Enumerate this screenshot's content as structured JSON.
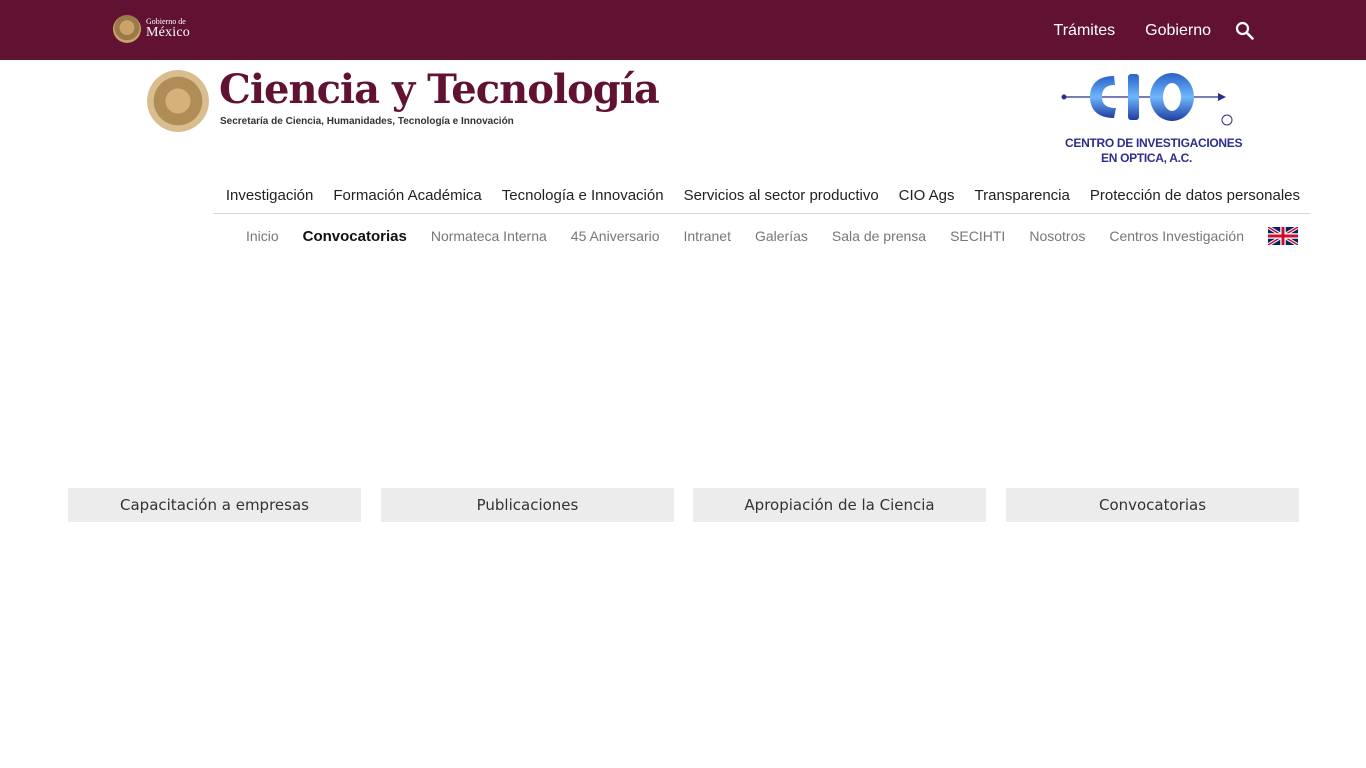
{
  "gov_bar": {
    "logo_small": "Gobierno de",
    "logo_big": "México",
    "nav": [
      "Trámites",
      "Gobierno"
    ],
    "search_icon": "search-icon"
  },
  "header": {
    "brand_title": "Ciencia y Tecnología",
    "brand_subtitle": "Secretaría de Ciencia, Humanidades, Tecnología e Innovación",
    "cio_line1": "CENTRO DE INVESTIGACIONES",
    "cio_line2": "EN OPTICA, A.C.",
    "cio_mark": "®"
  },
  "main_nav": [
    "Investigación",
    "Formación Académica",
    "Tecnología e Innovación",
    "Servicios al sector productivo",
    "CIO Ags",
    "Transparencia",
    "Protección de datos personales"
  ],
  "sub_nav": [
    "Inicio",
    "Convocatorias",
    "Normateca Interna",
    "45 Aniversario",
    "Intranet",
    "Galerías",
    "Sala de prensa",
    "SECIHTI",
    "Nosotros",
    "Centros Investigación"
  ],
  "sub_nav_active": "Convocatorias",
  "cards": [
    "Capacitación a empresas",
    "Publicaciones",
    "Apropiación de la Ciencia",
    "Convocatorias"
  ],
  "colors": {
    "gov_bar": "#611232",
    "brand": "#611232",
    "cio": "#2b2f8a",
    "card_bg": "#ececec"
  }
}
